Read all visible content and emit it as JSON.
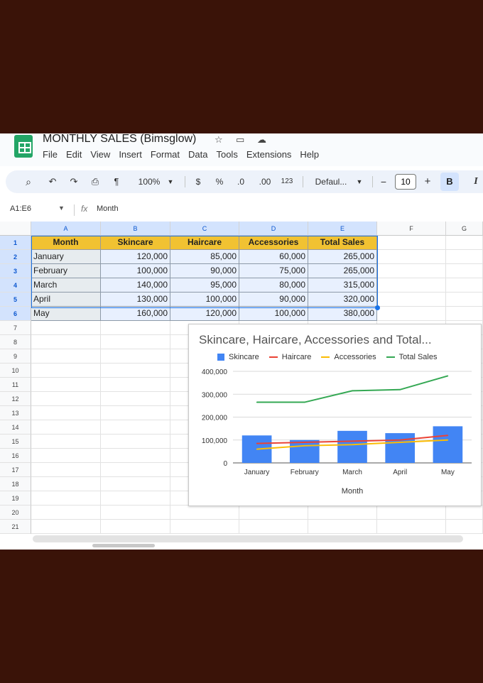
{
  "app": {
    "doc_title": "MONTHLY SALES (Bimsglow)",
    "menu": [
      "File",
      "Edit",
      "View",
      "Insert",
      "Format",
      "Data",
      "Tools",
      "Extensions",
      "Help"
    ]
  },
  "toolbar": {
    "zoom": "100%",
    "currency": "$",
    "percent": "%",
    "decrease_decimal": ".0",
    "increase_decimal": ".00",
    "number_format": "123",
    "font": "Defaul...",
    "minus": "−",
    "font_size": "10",
    "plus": "+",
    "bold": "B",
    "italic": "I"
  },
  "formula_bar": {
    "range": "A1:E6",
    "fx": "fx",
    "content": "Month"
  },
  "grid": {
    "columns": [
      "A",
      "B",
      "C",
      "D",
      "E",
      "F",
      "G"
    ],
    "rows": [
      "1",
      "2",
      "3",
      "4",
      "5",
      "6",
      "7",
      "8",
      "9",
      "10",
      "11",
      "12",
      "13",
      "14",
      "15",
      "16",
      "17",
      "18",
      "19",
      "20",
      "21"
    ],
    "header": [
      "Month",
      "Skincare",
      "Haircare",
      "Accessories",
      "Total Sales"
    ],
    "data": [
      [
        "January",
        "120,000",
        "85,000",
        "60,000",
        "265,000"
      ],
      [
        "February",
        "100,000",
        "90,000",
        "75,000",
        "265,000"
      ],
      [
        "March",
        "140,000",
        "95,000",
        "80,000",
        "315,000"
      ],
      [
        "April",
        "130,000",
        "100,000",
        "90,000",
        "320,000"
      ],
      [
        "May",
        "160,000",
        "120,000",
        "100,000",
        "380,000"
      ]
    ]
  },
  "chart_data": {
    "type": "bar",
    "title": "Skincare, Haircare, Accessories and Total...",
    "xlabel": "Month",
    "ylabel": "",
    "categories": [
      "January",
      "February",
      "March",
      "April",
      "May"
    ],
    "yticks": [
      "0",
      "100,000",
      "200,000",
      "300,000",
      "400,000"
    ],
    "ylim": [
      0,
      400000
    ],
    "legend_position": "top",
    "grid": true,
    "series": [
      {
        "name": "Skincare",
        "kind": "bar",
        "color": "#4285f4",
        "values": [
          120000,
          100000,
          140000,
          130000,
          160000
        ]
      },
      {
        "name": "Haircare",
        "kind": "line",
        "color": "#ea4335",
        "values": [
          85000,
          90000,
          95000,
          100000,
          120000
        ]
      },
      {
        "name": "Accessories",
        "kind": "line",
        "color": "#fbbc04",
        "values": [
          60000,
          75000,
          80000,
          90000,
          100000
        ]
      },
      {
        "name": "Total Sales",
        "kind": "line",
        "color": "#34a853",
        "values": [
          265000,
          265000,
          315000,
          320000,
          380000
        ]
      }
    ]
  }
}
